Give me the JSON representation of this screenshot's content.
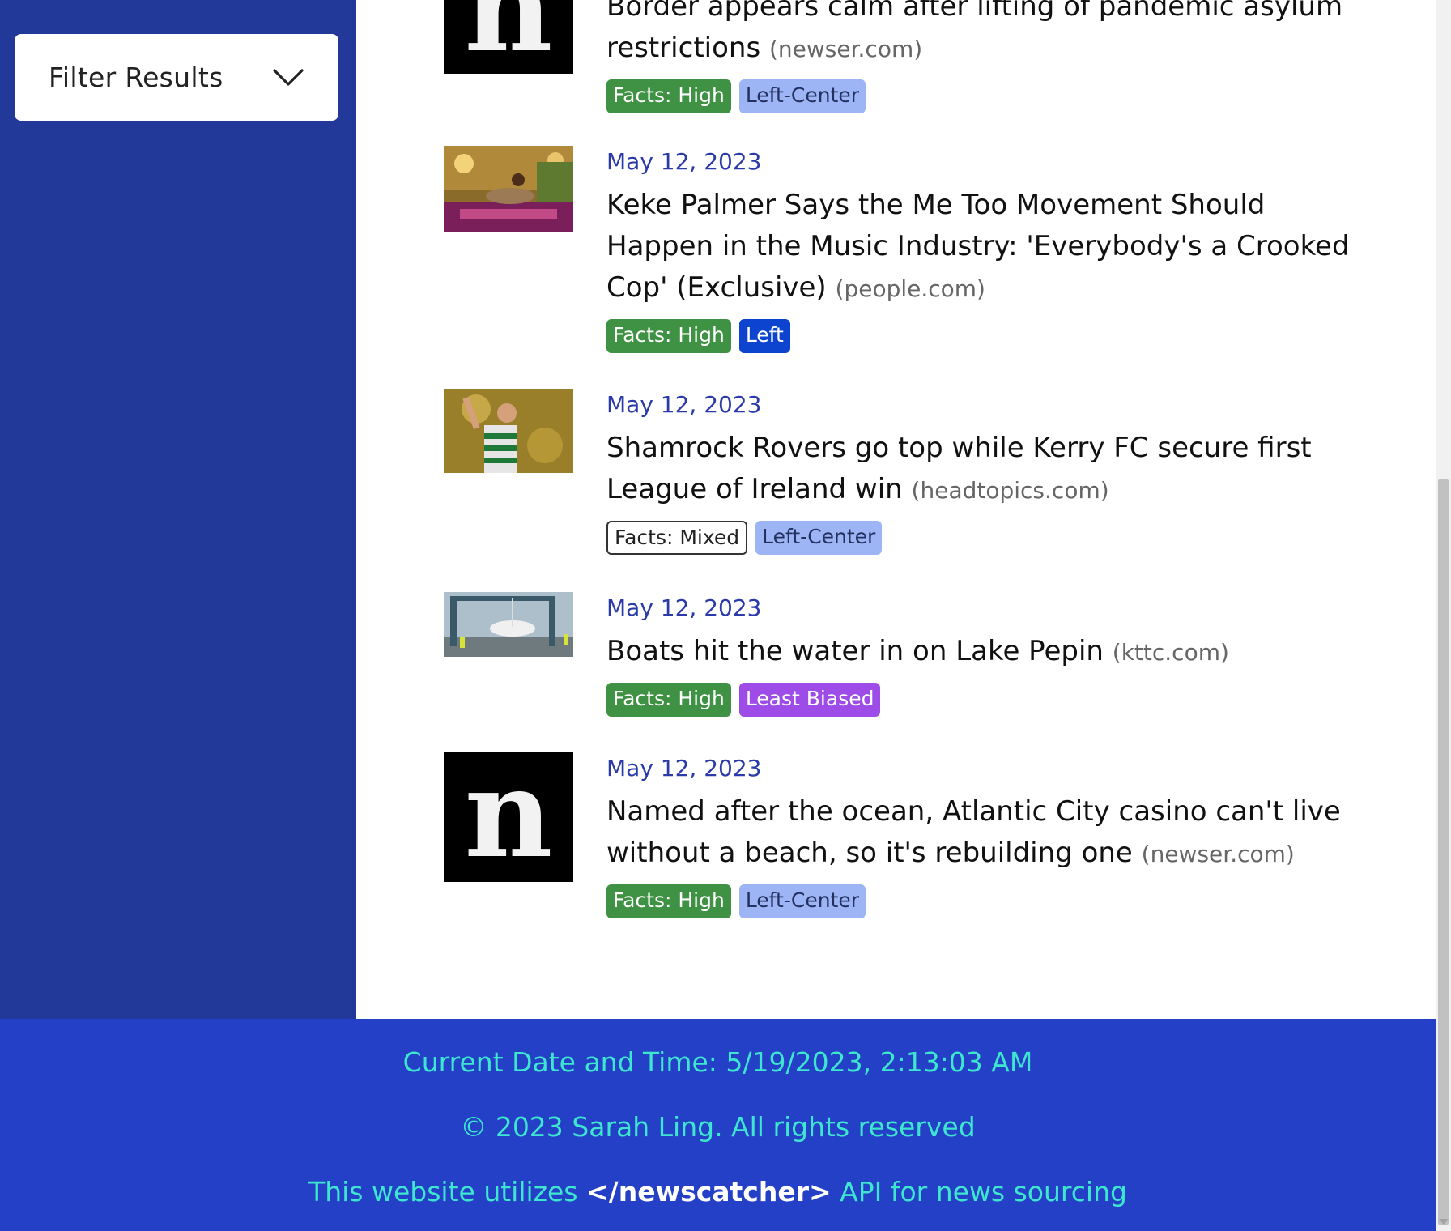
{
  "filter": {
    "label": "Filter Results",
    "icon": "chevron-down-icon"
  },
  "articles": [
    {
      "date": "",
      "title": "Border appears calm after lifting of pandemic asylum restrictions",
      "source": "(newser.com)",
      "image": "newser-logo",
      "tags": [
        {
          "label": "Facts: High",
          "kind": "high"
        },
        {
          "label": "Left-Center",
          "kind": "leftc"
        }
      ]
    },
    {
      "date": "May 12, 2023",
      "title": "Keke Palmer Says the Me Too Movement Should Happen in the Music Industry: 'Everybody's a Crooked Cop' (Exclusive)",
      "source": "(people.com)",
      "image": "keke-palmer-photo",
      "tags": [
        {
          "label": "Facts: High",
          "kind": "high"
        },
        {
          "label": "Left",
          "kind": "left"
        }
      ]
    },
    {
      "date": "May 12, 2023",
      "title": "Shamrock Rovers go top while Kerry FC secure first League of Ireland win",
      "source": "(headtopics.com)",
      "image": "soccer-player-photo",
      "tags": [
        {
          "label": "Facts: Mixed",
          "kind": "mixed"
        },
        {
          "label": "Left-Center",
          "kind": "leftc"
        }
      ]
    },
    {
      "date": "May 12, 2023",
      "title": "Boats hit the water in on Lake Pepin",
      "source": "(kttc.com)",
      "image": "boat-lift-photo",
      "tags": [
        {
          "label": "Facts: High",
          "kind": "high"
        },
        {
          "label": "Least Biased",
          "kind": "least"
        }
      ]
    },
    {
      "date": "May 12, 2023",
      "title": "Named after the ocean, Atlantic City casino can't live without a beach, so it's rebuilding one",
      "source": "(newser.com)",
      "image": "newser-logo",
      "tags": [
        {
          "label": "Facts: High",
          "kind": "high"
        },
        {
          "label": "Left-Center",
          "kind": "leftc"
        }
      ]
    }
  ],
  "footer": {
    "datetime": "Current Date and Time: 5/19/2023, 2:13:03 AM",
    "copyright": "© 2023 Sarah Ling. All rights reserved",
    "api_prefix": "This website utilizes ",
    "api_name": "</newscatcher>",
    "api_suffix": " API for news sourcing"
  },
  "colors": {
    "sidebar": "#233999",
    "footer": "#2340c6",
    "footer_text": "#3ee6d0",
    "date_text": "#2a3aa8",
    "facts_high": "#3f9143",
    "left_center": "#9db5f5",
    "left": "#0c43cf",
    "least_biased": "#9d4ce8"
  }
}
